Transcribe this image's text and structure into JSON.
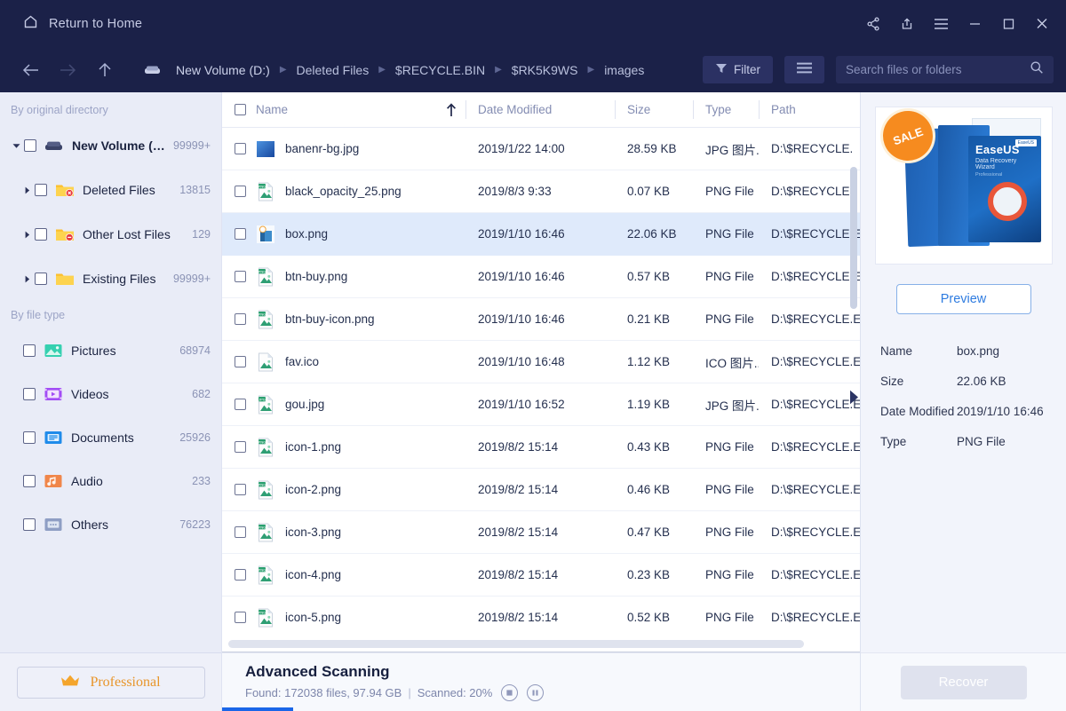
{
  "window": {
    "home_label": "Return to Home",
    "controls": [
      "share-icon",
      "export-icon",
      "menu-icon",
      "minimize-icon",
      "maximize-icon",
      "close-icon"
    ]
  },
  "nav": {
    "back": "back-arrow-icon",
    "forward": "forward-arrow-icon",
    "up": "up-arrow-icon",
    "breadcrumbs": [
      "New Volume (D:)",
      "Deleted Files",
      "$RECYCLE.BIN",
      "$RK5K9WS",
      "images"
    ],
    "filter_label": "Filter",
    "search_placeholder": "Search files or folders",
    "search_value": ""
  },
  "sidebar": {
    "section_directory": "By original directory",
    "section_filetype": "By file type",
    "tree": [
      {
        "label": "New Volume (D:)",
        "count": "99999+",
        "level": 1,
        "icon": "drive-icon",
        "expanded": true
      },
      {
        "label": "Deleted Files",
        "count": "13815",
        "level": 2,
        "icon": "folder-deleted-icon",
        "expanded": false
      },
      {
        "label": "Other Lost Files",
        "count": "129",
        "level": 2,
        "icon": "folder-lost-icon",
        "expanded": false
      },
      {
        "label": "Existing Files",
        "count": "99999+",
        "level": 2,
        "icon": "folder-icon",
        "expanded": false
      }
    ],
    "filetypes": [
      {
        "label": "Pictures",
        "count": "68974",
        "icon": "pictures-icon"
      },
      {
        "label": "Videos",
        "count": "682",
        "icon": "videos-icon"
      },
      {
        "label": "Documents",
        "count": "25926",
        "icon": "documents-icon"
      },
      {
        "label": "Audio",
        "count": "233",
        "icon": "audio-icon"
      },
      {
        "label": "Others",
        "count": "76223",
        "icon": "others-icon"
      }
    ],
    "professional_label": "Professional"
  },
  "filelist": {
    "columns": [
      "Name",
      "Date Modified",
      "Size",
      "Type",
      "Path"
    ],
    "sort_column": "Name",
    "sort_direction": "ascending",
    "rows": [
      {
        "name": "banenr-bg.jpg",
        "date": "2019/1/22 14:00",
        "size": "28.59 KB",
        "type": "JPG 图片...",
        "path": "D:\\$RECYCLE.",
        "icon": "image-thumb-blue",
        "selected": false
      },
      {
        "name": "black_opacity_25.png",
        "date": "2019/8/3 9:33",
        "size": "0.07 KB",
        "type": "PNG File",
        "path": "D:\\$RECYCLE.",
        "icon": "png-file-icon",
        "selected": false
      },
      {
        "name": "box.png",
        "date": "2019/1/10 16:46",
        "size": "22.06 KB",
        "type": "PNG File",
        "path": "D:\\$RECYCLE.E",
        "icon": "image-thumb-box",
        "selected": true
      },
      {
        "name": "btn-buy.png",
        "date": "2019/1/10 16:46",
        "size": "0.57 KB",
        "type": "PNG File",
        "path": "D:\\$RECYCLE.E",
        "icon": "png-file-icon",
        "selected": false
      },
      {
        "name": "btn-buy-icon.png",
        "date": "2019/1/10 16:46",
        "size": "0.21 KB",
        "type": "PNG File",
        "path": "D:\\$RECYCLE.E",
        "icon": "png-file-icon",
        "selected": false
      },
      {
        "name": "fav.ico",
        "date": "2019/1/10 16:48",
        "size": "1.12 KB",
        "type": "ICO 图片...",
        "path": "D:\\$RECYCLE.E",
        "icon": "ico-file-icon",
        "selected": false
      },
      {
        "name": "gou.jpg",
        "date": "2019/1/10 16:52",
        "size": "1.19 KB",
        "type": "JPG 图片...",
        "path": "D:\\$RECYCLE.E",
        "icon": "jpg-file-icon",
        "selected": false
      },
      {
        "name": "icon-1.png",
        "date": "2019/8/2 15:14",
        "size": "0.43 KB",
        "type": "PNG File",
        "path": "D:\\$RECYCLE.E",
        "icon": "png-file-icon",
        "selected": false
      },
      {
        "name": "icon-2.png",
        "date": "2019/8/2 15:14",
        "size": "0.46 KB",
        "type": "PNG File",
        "path": "D:\\$RECYCLE.E",
        "icon": "png-file-icon",
        "selected": false
      },
      {
        "name": "icon-3.png",
        "date": "2019/8/2 15:14",
        "size": "0.47 KB",
        "type": "PNG File",
        "path": "D:\\$RECYCLE.E",
        "icon": "png-file-icon",
        "selected": false
      },
      {
        "name": "icon-4.png",
        "date": "2019/8/2 15:14",
        "size": "0.23 KB",
        "type": "PNG File",
        "path": "D:\\$RECYCLE.E",
        "icon": "png-file-icon",
        "selected": false
      },
      {
        "name": "icon-5.png",
        "date": "2019/8/2 15:14",
        "size": "0.52 KB",
        "type": "PNG File",
        "path": "D:\\$RECYCLE.E",
        "icon": "png-file-icon",
        "selected": false
      }
    ]
  },
  "preview": {
    "thumbnail_alt": "EaseUS Data Recovery Wizard box art",
    "badge": "SALE",
    "box_title": "EaseUS",
    "box_subtitle": "Data Recovery Wizard",
    "box_edition": "Professional",
    "box_tag": "EaseUS",
    "preview_label": "Preview",
    "details": [
      {
        "key": "Name",
        "value": "box.png"
      },
      {
        "key": "Size",
        "value": "22.06 KB"
      },
      {
        "key": "Date Modified",
        "value": "2019/1/10 16:46"
      },
      {
        "key": "Type",
        "value": "PNG File"
      }
    ],
    "recover_label": "Recover"
  },
  "status": {
    "title": "Advanced Scanning",
    "found": "Found: 172038 files, 97.94 GB",
    "separator": "|",
    "scanned": "Scanned: 20%",
    "progress_percent": 20,
    "stop_label": "stop-icon",
    "pause_label": "pause-icon"
  },
  "colors": {
    "chrome": "#1b2148",
    "accent": "#1a66e8",
    "selection": "#dfeafb",
    "pro_orange": "#e8952a"
  }
}
